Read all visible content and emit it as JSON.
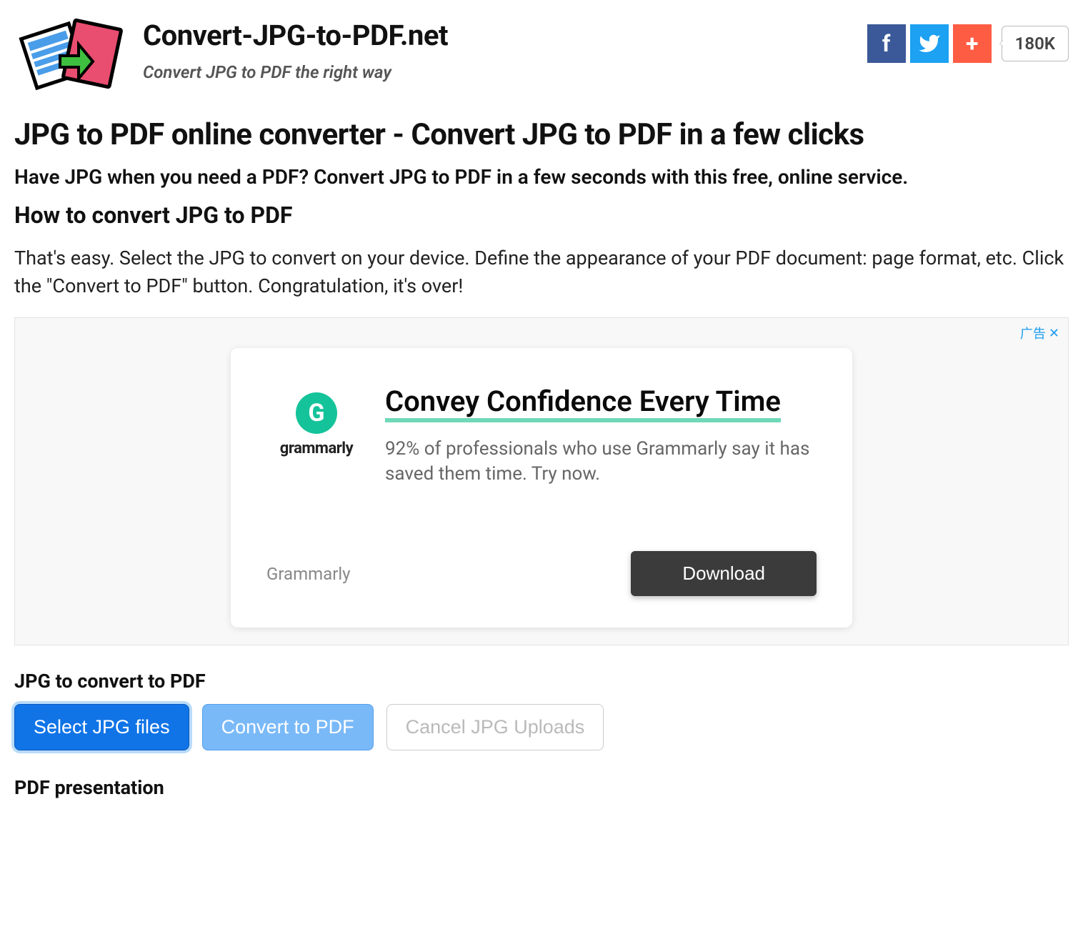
{
  "header": {
    "site_title": "Convert-JPG-to-PDF.net",
    "tagline": "Convert JPG to PDF the right way",
    "share_count": "180K"
  },
  "headings": {
    "h1": "JPG to PDF online converter - Convert JPG to PDF in a few clicks",
    "lead": "Have JPG when you need a PDF? Convert JPG to PDF in a few seconds with this free, online service.",
    "how_h2": "How to convert JPG to PDF",
    "how_body": "That's easy. Select the JPG to convert on your device. Define the appearance of your PDF document: page format, etc. Click the \"Convert to PDF\" button. Congratulation, it's over!"
  },
  "ad": {
    "corner_label": "广告",
    "logo_letter": "G",
    "logo_text": "grammarly",
    "headline": "Convey Confidence Every Time",
    "subtext": "92% of professionals who use Grammarly say it has saved them time. Try now.",
    "brand_footer": "Grammarly",
    "download_label": "Download"
  },
  "upload": {
    "section_label": "JPG to convert to PDF",
    "select_btn": "Select JPG files",
    "convert_btn": "Convert to PDF",
    "cancel_btn": "Cancel JPG Uploads"
  },
  "presentation": {
    "section_label": "PDF presentation"
  }
}
